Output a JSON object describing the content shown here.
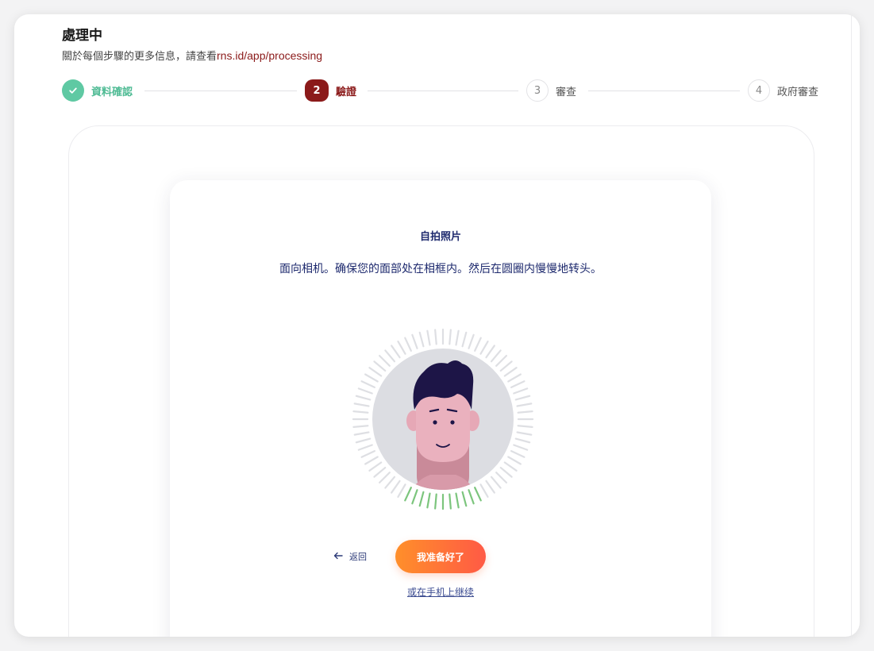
{
  "header": {
    "title": "處理中",
    "subtitle_prefix": "關於每個步驟的更多信息，請查看",
    "subtitle_link": "rns.id/app/processing"
  },
  "stepper": {
    "steps": [
      {
        "marker": "",
        "label": "資料確認",
        "state": "completed"
      },
      {
        "marker": "2",
        "label": "驗證",
        "state": "active"
      },
      {
        "marker": "3",
        "label": "審查",
        "state": "pending"
      },
      {
        "marker": "4",
        "label": "政府審查",
        "state": "pending"
      }
    ]
  },
  "selfie_card": {
    "title": "自拍照片",
    "instructions": "面向相机。确保您的面部处在相框内。然后在圆圈内慢慢地转头。",
    "back_icon": "arrow-left-icon",
    "back_label": "返回",
    "ready_button_label": "我准备好了",
    "continue_on_phone_label": "或在手机上继续"
  },
  "colors": {
    "accent_red": "#8b1a1a",
    "success_green": "#5fc9a3",
    "text_navy": "#1e2a6e",
    "button_gradient_start": "#ff8f2a",
    "button_gradient_end": "#ff5a45",
    "progress_tick_green": "#7cc57d"
  }
}
